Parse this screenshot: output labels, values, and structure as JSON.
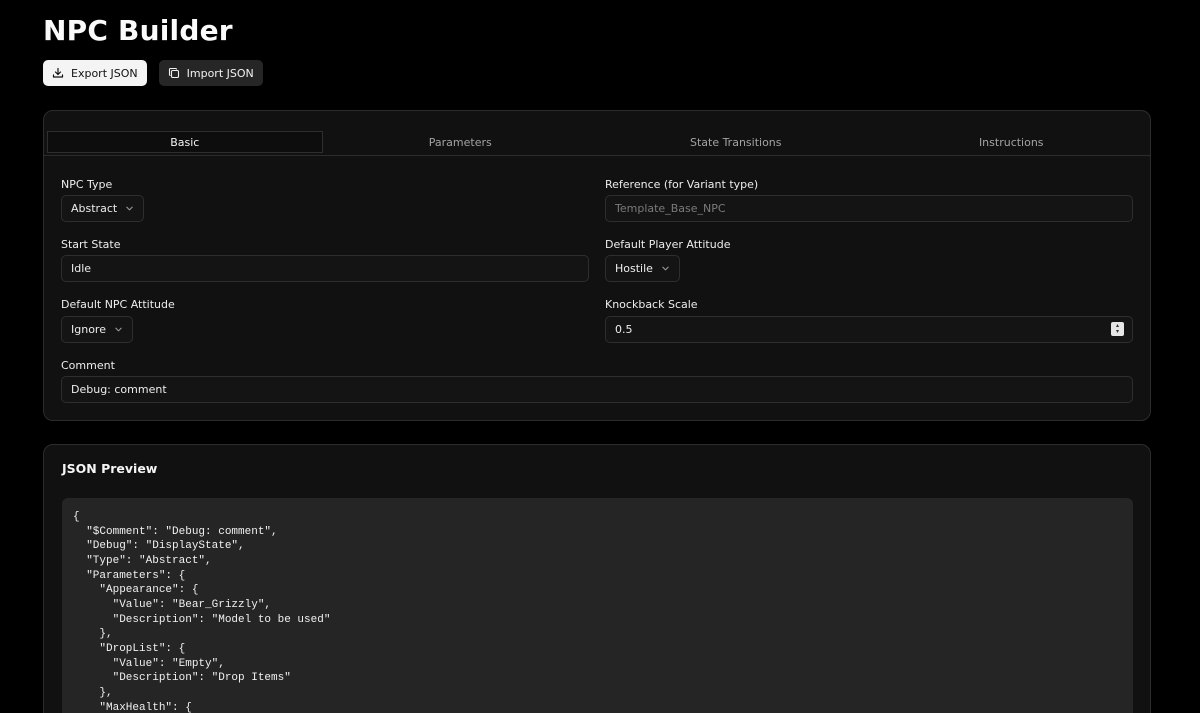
{
  "page": {
    "title": "NPC Builder"
  },
  "toolbar": {
    "export_label": "Export JSON",
    "import_label": "Import JSON",
    "export_icon": "download-icon",
    "import_icon": "copy-icon"
  },
  "tabs": [
    {
      "label": "Basic",
      "active": true
    },
    {
      "label": "Parameters",
      "active": false
    },
    {
      "label": "State Transitions",
      "active": false
    },
    {
      "label": "Instructions",
      "active": false
    }
  ],
  "form": {
    "npc_type": {
      "label": "NPC Type",
      "value": "Abstract"
    },
    "reference": {
      "label": "Reference (for Variant type)",
      "placeholder": "Template_Base_NPC",
      "value": ""
    },
    "start_state": {
      "label": "Start State",
      "value": "Idle"
    },
    "player_attitude": {
      "label": "Default Player Attitude",
      "value": "Hostile"
    },
    "npc_attitude": {
      "label": "Default NPC Attitude",
      "value": "Ignore"
    },
    "knockback": {
      "label": "Knockback Scale",
      "value": "0.5"
    },
    "comment": {
      "label": "Comment",
      "value": "Debug: comment"
    }
  },
  "json_preview": {
    "title": "JSON Preview",
    "lines": [
      "{",
      "  \"$Comment\": \"Debug: comment\",",
      "  \"Debug\": \"DisplayState\",",
      "  \"Type\": \"Abstract\",",
      "  \"Parameters\": {",
      "    \"Appearance\": {",
      "      \"Value\": \"Bear_Grizzly\",",
      "      \"Description\": \"Model to be used\"",
      "    },",
      "    \"DropList\": {",
      "      \"Value\": \"Empty\",",
      "      \"Description\": \"Drop Items\"",
      "    },",
      "    \"MaxHealth\": {"
    ]
  }
}
